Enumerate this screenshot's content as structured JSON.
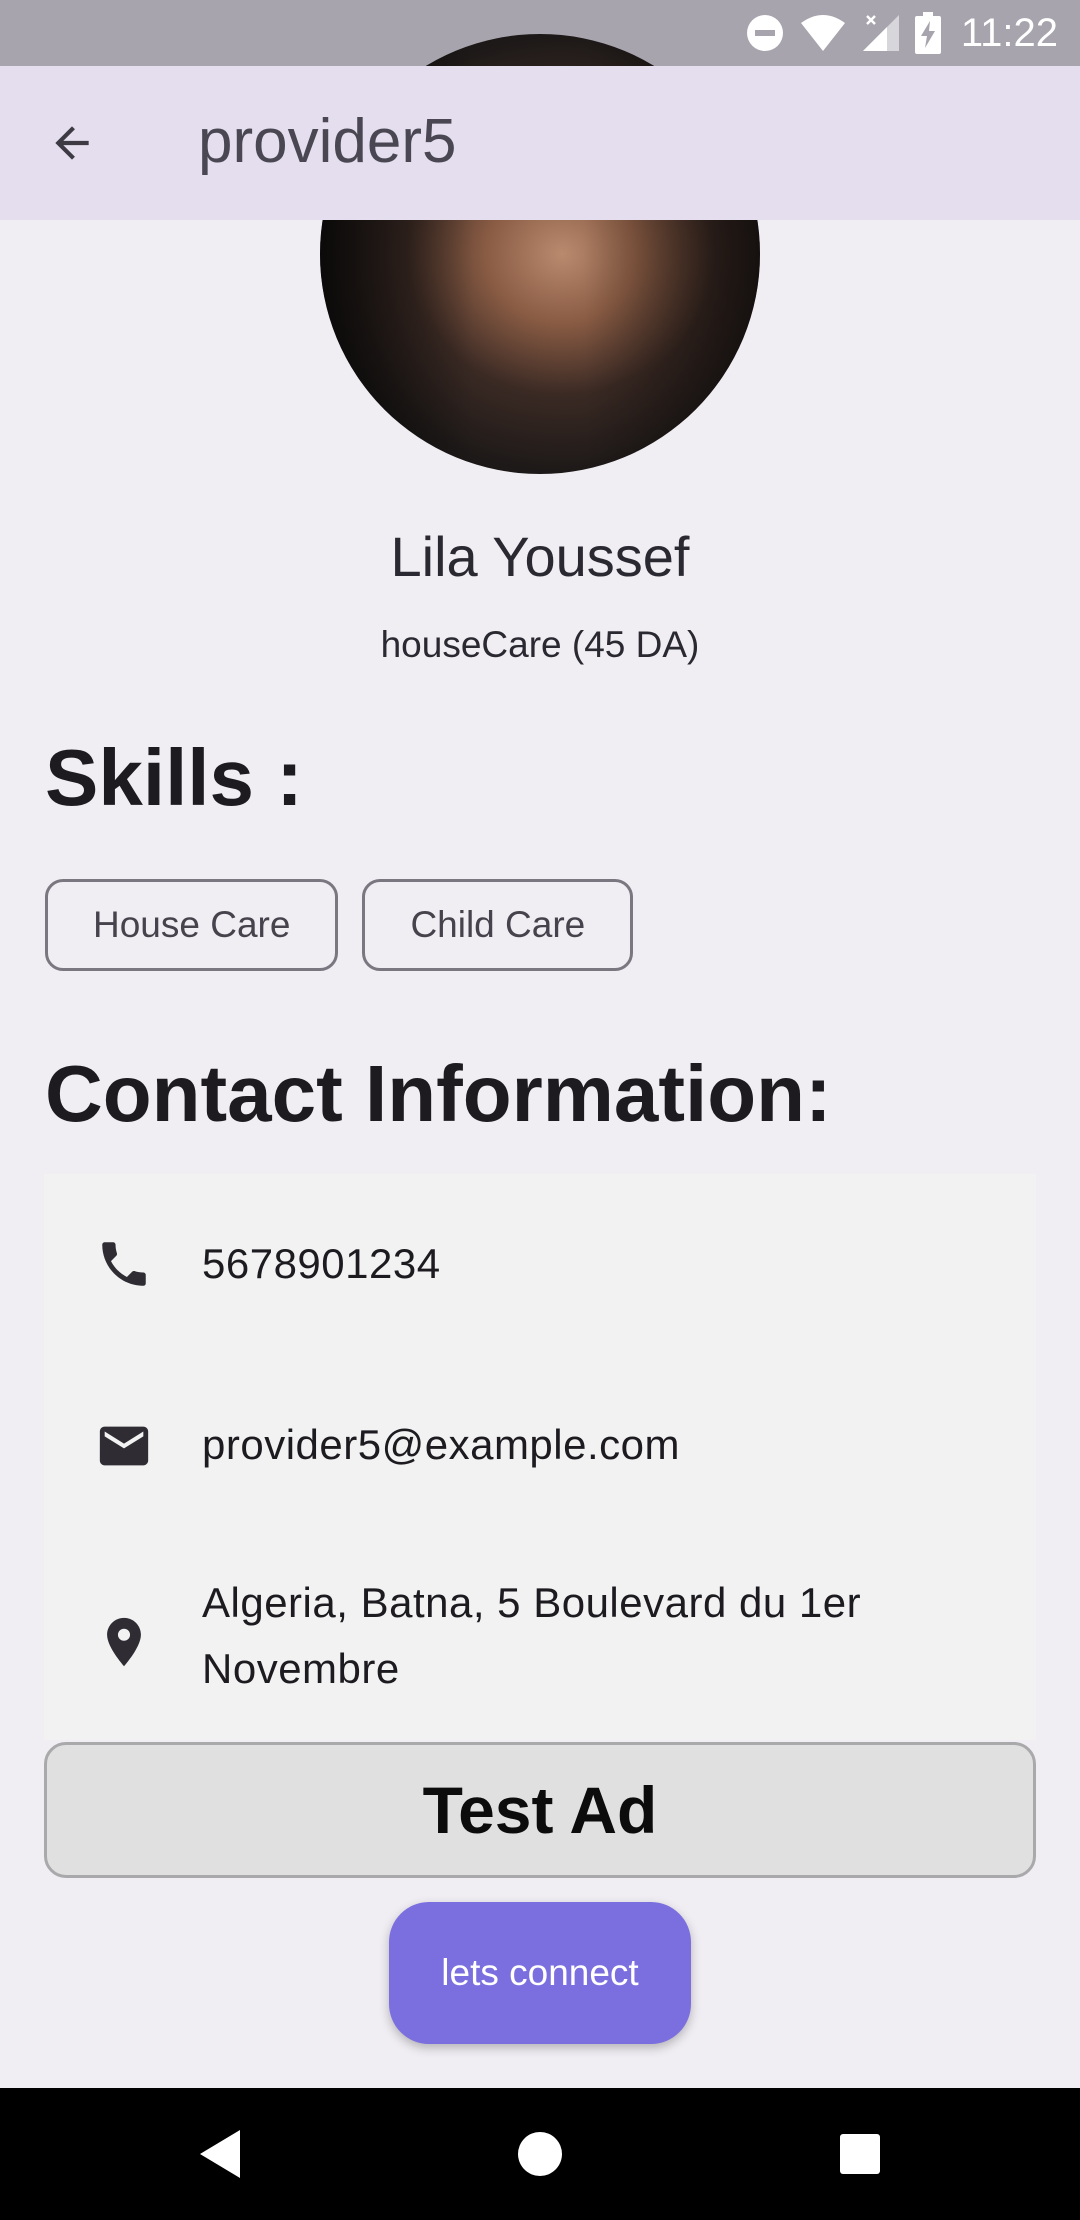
{
  "status_bar": {
    "time": "11:22",
    "icons": [
      "do-not-disturb-icon",
      "wifi-icon",
      "signal-icon",
      "battery-charging-icon"
    ]
  },
  "app_bar": {
    "title": "provider5",
    "back_icon": "arrow-back-icon"
  },
  "profile": {
    "name": "Lila Youssef",
    "subtitle": "houseCare (45 DA)"
  },
  "skills": {
    "heading": "Skills :",
    "items": [
      "House Care",
      "Child Care"
    ]
  },
  "contact": {
    "heading": "Contact Information:",
    "phone": "5678901234",
    "email": "provider5@example.com",
    "address_line1": "Algeria, Batna, 5 Boulevard du 1er",
    "address_line2": "Novembre"
  },
  "ad": {
    "label": "Test Ad"
  },
  "connect_button": {
    "label": "lets connect"
  },
  "colors": {
    "app_bar_bg": "#e4deee",
    "page_bg": "#f0eef3",
    "accent": "#7b6fe0"
  }
}
